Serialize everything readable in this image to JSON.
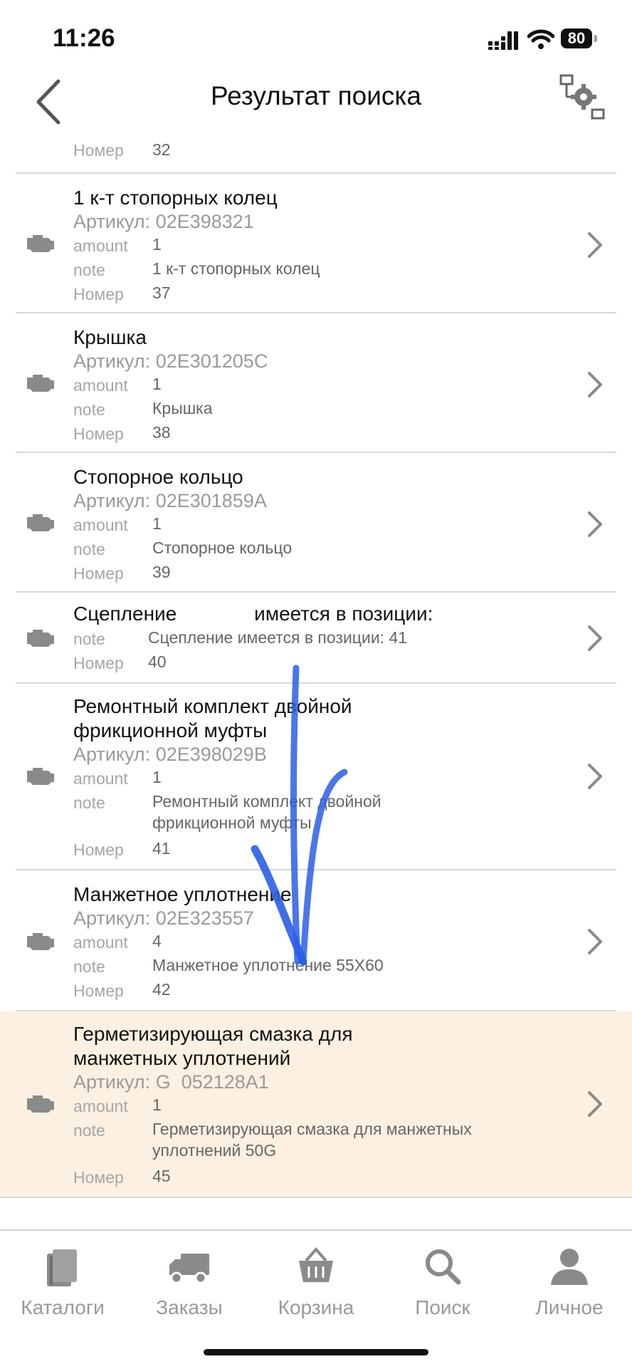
{
  "status": {
    "time": "11:26",
    "battery": "80"
  },
  "header": {
    "title": "Результат поиска"
  },
  "labels": {
    "article": "Артикул:",
    "amount": "amount",
    "note": "note",
    "number": "Номер"
  },
  "items": [
    {
      "number": "32"
    },
    {
      "name": "1 к-т стопорных колец",
      "article": "02E398321",
      "amount": "1",
      "note": "1 к-т стопорных колец",
      "number": "37"
    },
    {
      "name": "Крышка",
      "article": "02E301205C",
      "amount": "1",
      "note": "Крышка",
      "number": "38"
    },
    {
      "name": "Стопорное кольцо",
      "article": "02E301859A",
      "amount": "1",
      "note": "Стопорное кольцо",
      "number": "39"
    },
    {
      "name": "Сцепление              имеется в позиции:",
      "note": "Сцепление имеется в позиции: 41",
      "number": "40"
    },
    {
      "name_line1": "Ремонтный комплект двойной",
      "name_line2": "фрикционной муфты",
      "article": "02E398029B",
      "amount": "1",
      "note_line1": "Ремонтный комплект двойной",
      "note_line2": "фрикционной муфты",
      "number": "41"
    },
    {
      "name": "Манжетное уплотнение",
      "article": "02E323557",
      "amount": "4",
      "note": "Манжетное уплотнение 55X60",
      "number": "42"
    },
    {
      "name_line1": "Герметизирующая смазка для",
      "name_line2": "манжетных уплотнений",
      "article": "G  052128A1",
      "amount": "1",
      "note_line1": "Герметизирующая смазка для манжетных",
      "note_line2": "уплотнений 50G",
      "number": "45"
    }
  ],
  "tabs": [
    {
      "label": "Каталоги",
      "icon": "books-icon"
    },
    {
      "label": "Заказы",
      "icon": "truck-icon"
    },
    {
      "label": "Корзина",
      "icon": "basket-icon"
    },
    {
      "label": "Поиск",
      "icon": "search-icon"
    },
    {
      "label": "Личное",
      "icon": "person-icon"
    }
  ],
  "colors": {
    "highlight": "#fbf0e1",
    "icon_gray": "#8a8a8a",
    "scribble": "#2a5ee8"
  }
}
